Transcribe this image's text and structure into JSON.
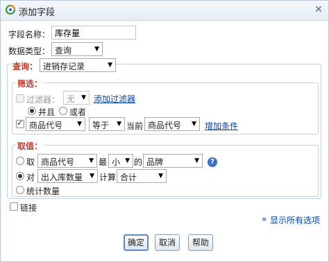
{
  "window": {
    "title": "添加字段"
  },
  "field_name": {
    "label": "字段名称：",
    "value": "库存量"
  },
  "data_type": {
    "label": "数据类型：",
    "selected": "查询"
  },
  "query": {
    "label": "查询：",
    "selected": "进销存记录"
  },
  "filter_section": {
    "title": "筛选：",
    "filter_label": "过滤器：",
    "filter_selected": "无",
    "add_filter_link": "添加过滤器",
    "and_label": "并且",
    "or_label": "或者",
    "cond_field": "商品代号",
    "cond_op": "等于",
    "cond_current": "当前",
    "cond_value": "商品代号",
    "add_condition_link": "增加条件"
  },
  "value_section": {
    "title": "取值：",
    "take_label": "取",
    "take_field": "商品代号",
    "most_label": "最",
    "minmax": "小",
    "of_label": "的",
    "target_field": "品牌",
    "pair_label": "对",
    "pair_field": "出入库数量",
    "calc_label": "计算",
    "calc_func": "合计",
    "count_label": "统计数量"
  },
  "link_label": "链接",
  "show_all_link": "显示所有选项",
  "buttons": {
    "ok": "确定",
    "cancel": "取消",
    "help": "帮助"
  }
}
